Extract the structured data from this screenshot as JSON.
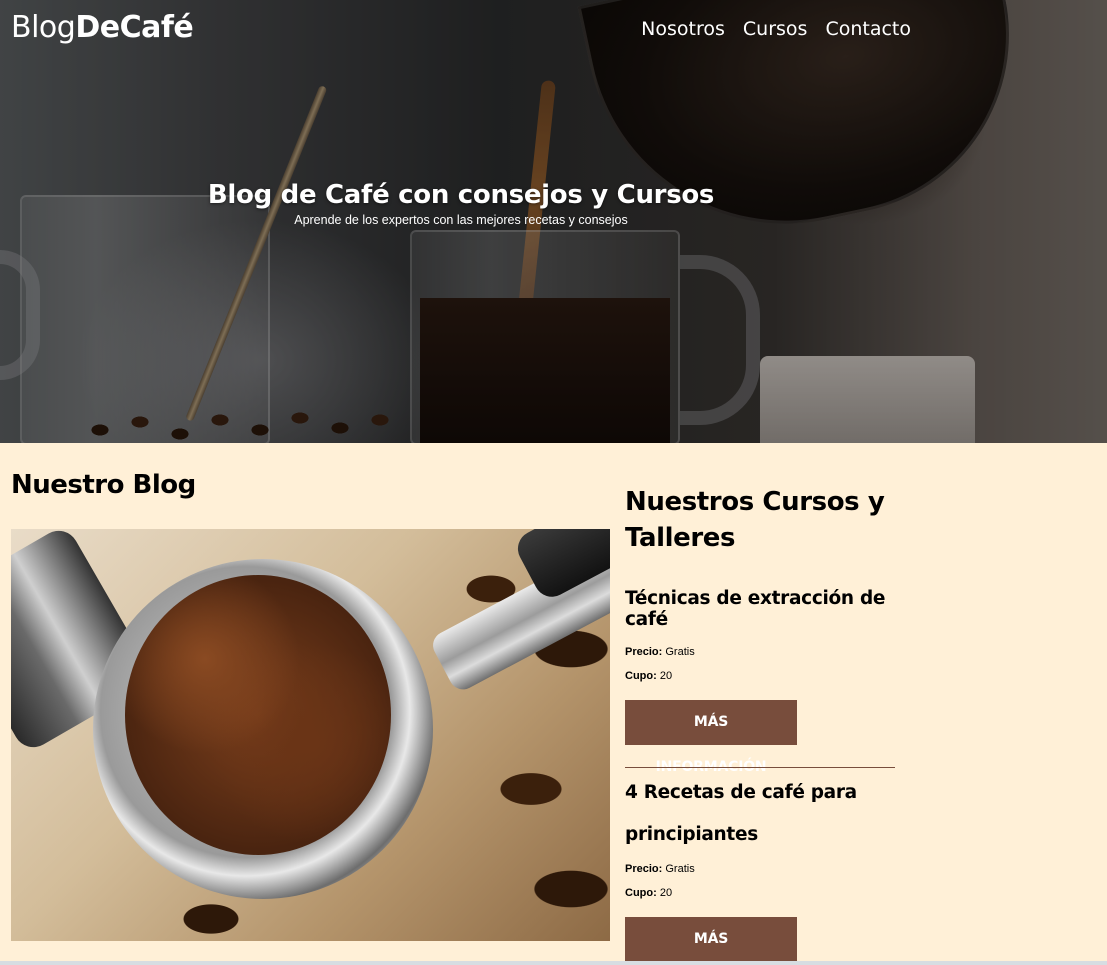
{
  "header": {
    "logo_light": "Blog",
    "logo_bold": "DeCafé",
    "nav": [
      {
        "label": "Nosotros"
      },
      {
        "label": "Cursos"
      },
      {
        "label": "Contacto"
      }
    ]
  },
  "hero": {
    "title": "Blog de Café con consejos y Cursos",
    "subtitle": "Aprende de los expertos con las mejores recetas y consejos"
  },
  "blog": {
    "title": "Nuestro Blog"
  },
  "courses": {
    "title": "Nuestros Cursos y Talleres",
    "items": [
      {
        "name": "Técnicas de extracción de café",
        "price_label": "Precio:",
        "price": "Gratis",
        "quota_label": "Cupo:",
        "quota": "20",
        "button": "Más Información"
      },
      {
        "name": "4 Recetas de café para principiantes",
        "price_label": "Precio:",
        "price": "Gratis",
        "quota_label": "Cupo:",
        "quota": "20",
        "button": "Más Información"
      }
    ]
  },
  "colors": {
    "background": "#fff0d7",
    "accent": "#784d3c"
  }
}
